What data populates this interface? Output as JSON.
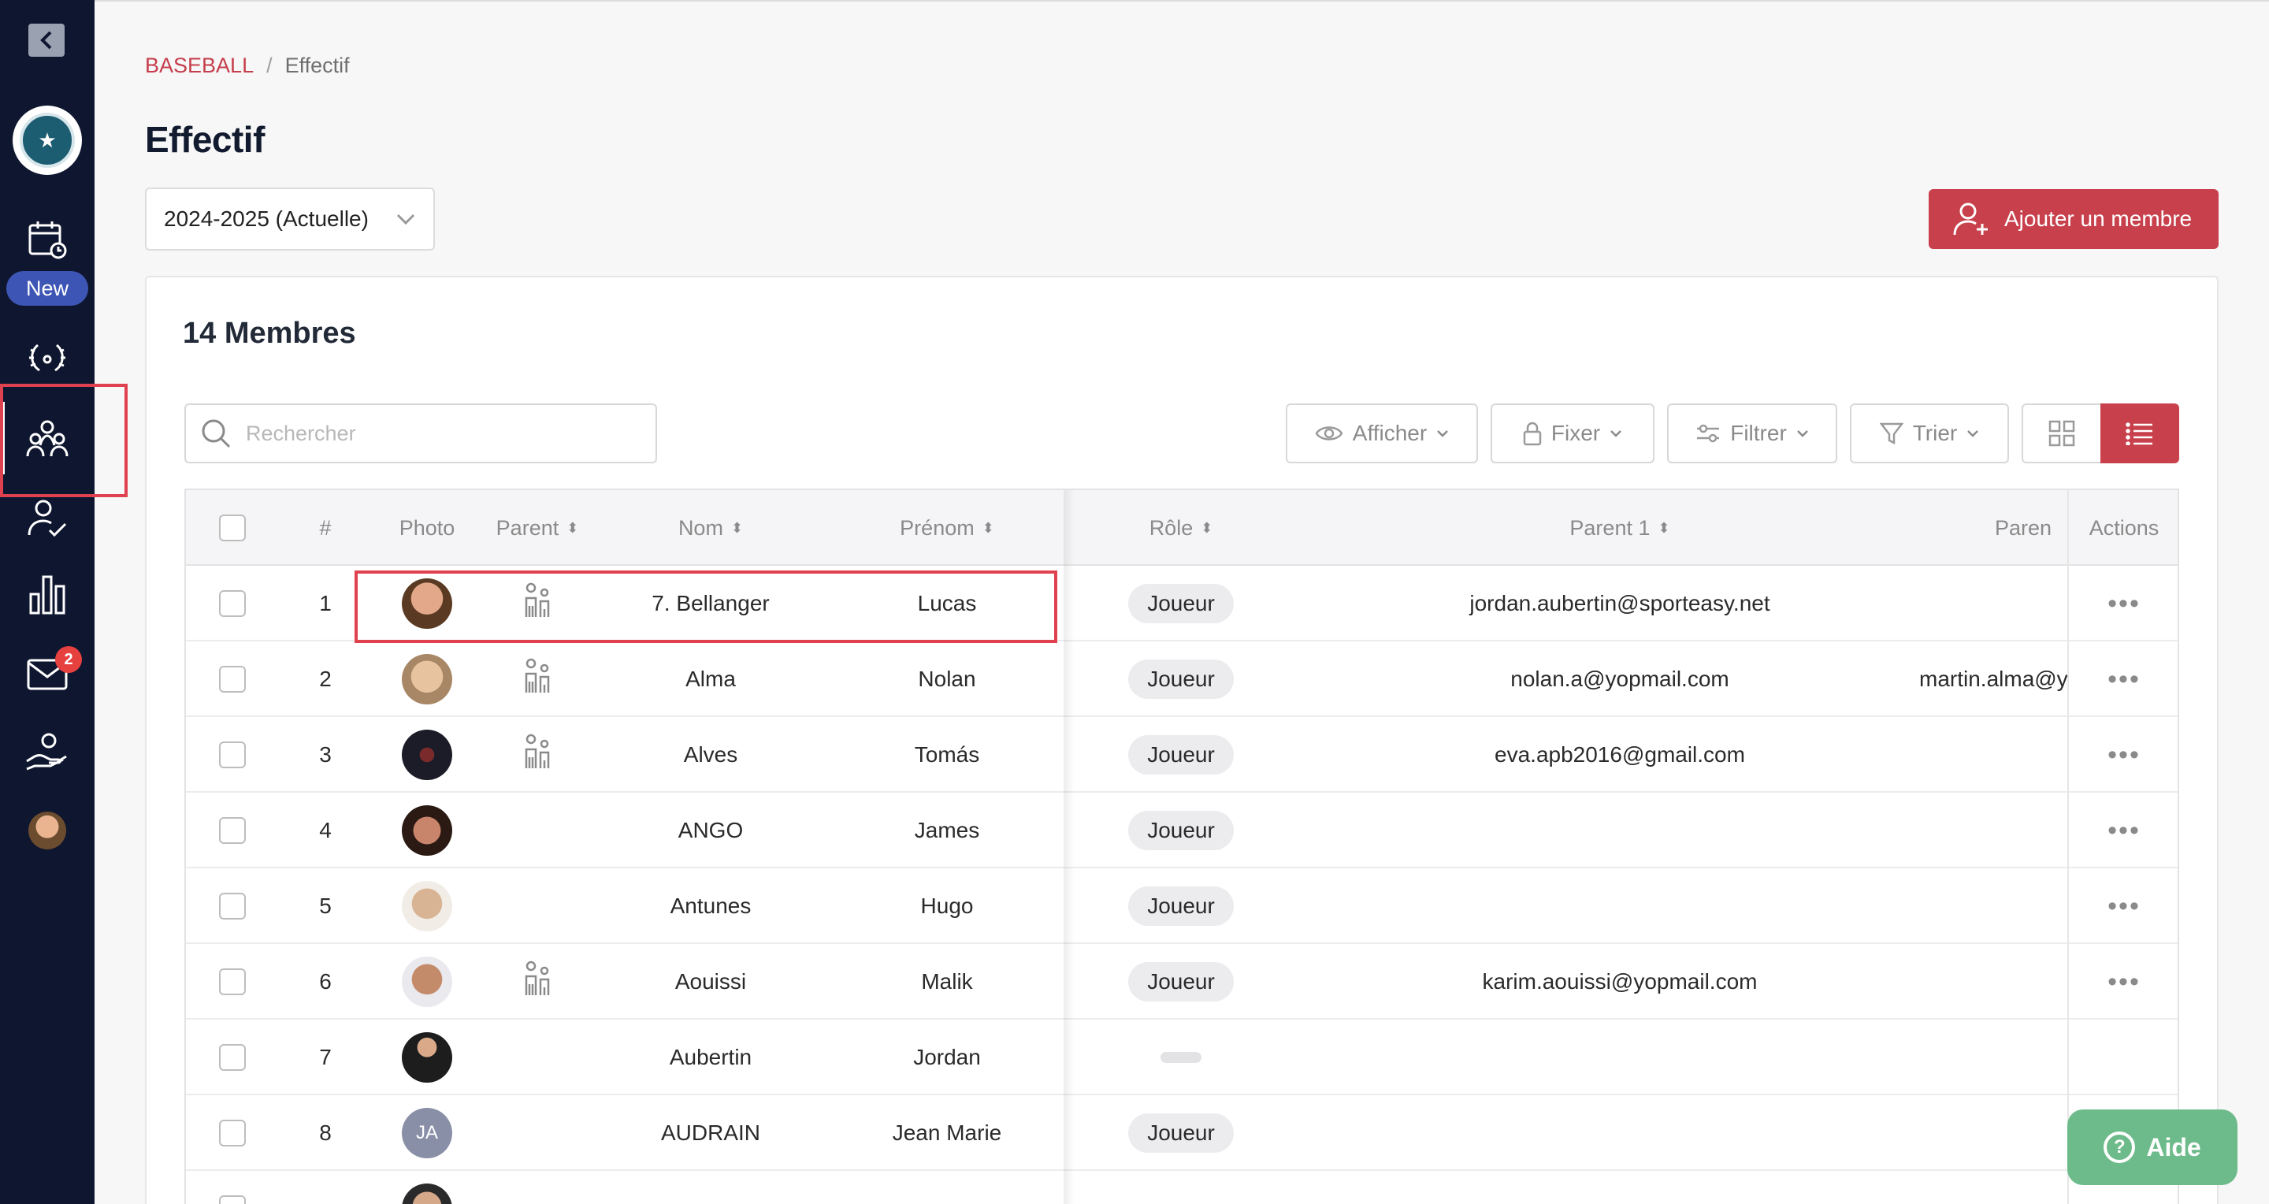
{
  "breadcrumb": {
    "section": "BASEBALL",
    "separator": "/",
    "current": "Effectif"
  },
  "page": {
    "title": "Effectif"
  },
  "season": {
    "selected": "2024-2025 (Actuelle)"
  },
  "actions": {
    "add_member": "Ajouter un membre"
  },
  "sidebar": {
    "new_badge": "New",
    "messages_count": "2",
    "icons": [
      "collapse-icon",
      "calendar-icon",
      "laurel-icon",
      "team-icon",
      "person-check-icon",
      "stats-icon",
      "mail-icon",
      "hand-heart-icon"
    ]
  },
  "members": {
    "count_label": "14 Membres",
    "search_placeholder": "Rechercher",
    "toolbar": {
      "afficher": "Afficher",
      "fixer": "Fixer",
      "filtrer": "Filtrer",
      "trier": "Trier"
    }
  },
  "table": {
    "headers": {
      "num": "#",
      "photo": "Photo",
      "parent": "Parent",
      "nom": "Nom",
      "prenom": "Prénom",
      "role": "Rôle",
      "parent1": "Parent 1",
      "parent2": "Paren",
      "actions": "Actions"
    },
    "rows": [
      {
        "num": "1",
        "nom": "7. Bellanger",
        "prenom": "Lucas",
        "role": "Joueur",
        "parent1": "jordan.aubertin@sporteasy.net",
        "parent2": "",
        "has_parent": true
      },
      {
        "num": "2",
        "nom": "Alma",
        "prenom": "Nolan",
        "role": "Joueur",
        "parent1": "nolan.a@yopmail.com",
        "parent2": "martin.alma@y",
        "has_parent": true
      },
      {
        "num": "3",
        "nom": "Alves",
        "prenom": "Tomás",
        "role": "Joueur",
        "parent1": "eva.apb2016@gmail.com",
        "parent2": "",
        "has_parent": true
      },
      {
        "num": "4",
        "nom": "ANGO",
        "prenom": "James",
        "role": "Joueur",
        "parent1": "",
        "parent2": "",
        "has_parent": false
      },
      {
        "num": "5",
        "nom": "Antunes",
        "prenom": "Hugo",
        "role": "Joueur",
        "parent1": "",
        "parent2": "",
        "has_parent": false
      },
      {
        "num": "6",
        "nom": "Aouissi",
        "prenom": "Malik",
        "role": "Joueur",
        "parent1": "karim.aouissi@yopmail.com",
        "parent2": "",
        "has_parent": true
      },
      {
        "num": "7",
        "nom": "Aubertin",
        "prenom": "Jordan",
        "role": "",
        "parent1": "",
        "parent2": "",
        "has_parent": false
      },
      {
        "num": "8",
        "nom": "AUDRAIN",
        "prenom": "Jean Marie",
        "role": "Joueur",
        "parent1": "",
        "parent2": "",
        "has_parent": false,
        "initials": "JA"
      }
    ]
  },
  "help": {
    "label": "Aide"
  },
  "colors": {
    "sidebar": "#0f1630",
    "accent": "#c8404b",
    "highlight": "#e0414f",
    "help": "#6dbb8a",
    "new_badge": "#3d55b5"
  }
}
